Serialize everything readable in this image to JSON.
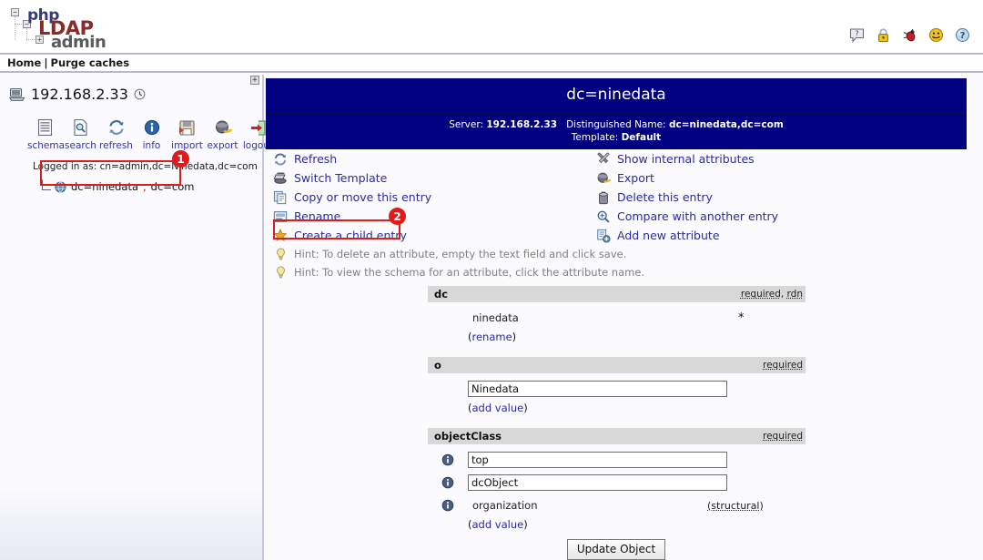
{
  "app": {
    "logo": {
      "part1": "php",
      "part2": "LDAP",
      "part3": "admin"
    },
    "top_icons": [
      {
        "name": "help-bubble-icon",
        "glyph": "?"
      },
      {
        "name": "lock-icon",
        "glyph": "⚿"
      },
      {
        "name": "bug-icon",
        "glyph": "✺"
      },
      {
        "name": "smiley-icon",
        "glyph": "☺"
      },
      {
        "name": "question-help-icon",
        "glyph": "?"
      }
    ]
  },
  "breadcrumb": {
    "home": "Home",
    "separator": "|",
    "purge": "Purge caches"
  },
  "sidebar": {
    "expand_glyph": "+",
    "server": "192.168.2.33",
    "tools": [
      {
        "label": "schema",
        "icon": "schema-icon"
      },
      {
        "label": "search",
        "icon": "search-icon"
      },
      {
        "label": "refresh",
        "icon": "refresh-icon"
      },
      {
        "label": "info",
        "icon": "info-icon"
      },
      {
        "label": "import",
        "icon": "import-icon"
      },
      {
        "label": "export",
        "icon": "export-icon"
      },
      {
        "label": "logout",
        "icon": "logout-icon"
      }
    ],
    "logged_in_label": "Logged in as: ",
    "logged_in_dn": "cn=admin,dc=Ninedata,dc=com",
    "tree_entry": {
      "prefix": "dc=ninedata",
      "comma": ",",
      "suffix": "dc=com"
    }
  },
  "entry": {
    "title": "dc=ninedata",
    "server_label": "Server:",
    "server_value": "192.168.2.33",
    "dn_label": "Distinguished Name:",
    "dn_value": "dc=ninedata,dc=com",
    "template_label": "Template:",
    "template_value": "Default"
  },
  "actions_left": [
    {
      "label": "Refresh",
      "icon": "refresh-icon"
    },
    {
      "label": "Switch Template",
      "icon": "switch-template-icon"
    },
    {
      "label": "Copy or move this entry",
      "icon": "copy-icon"
    },
    {
      "label": "Rename",
      "icon": "rename-icon"
    },
    {
      "label": "Create a child entry",
      "icon": "create-child-star-icon"
    }
  ],
  "actions_right": [
    {
      "label": "Show internal attributes",
      "icon": "tools-icon"
    },
    {
      "label": "Export",
      "icon": "export-icon"
    },
    {
      "label": "Delete this entry",
      "icon": "trash-icon"
    },
    {
      "label": "Compare with another entry",
      "icon": "compare-icon"
    },
    {
      "label": "Add new attribute",
      "icon": "add-attribute-icon"
    }
  ],
  "hints": [
    "Hint: To delete an attribute, empty the text field and click save.",
    "Hint: To view the schema for an attribute, click the attribute name."
  ],
  "attributes": [
    {
      "name": "dc",
      "flags_required": "required",
      "flags_sep": ", ",
      "flags_rdn": "rdn",
      "values": [
        {
          "value": "ninedata",
          "readonly": true,
          "suffix": "*",
          "info_icon": false
        }
      ],
      "action_prefix": "(",
      "action_label": "rename",
      "action_suffix": ")"
    },
    {
      "name": "o",
      "flags_required": "required",
      "flags_sep": "",
      "flags_rdn": "",
      "values": [
        {
          "value": "Ninedata",
          "readonly": false,
          "suffix": "",
          "info_icon": false
        }
      ],
      "action_prefix": "(",
      "action_label": "add value",
      "action_suffix": ")"
    },
    {
      "name": "objectClass",
      "flags_required": "required",
      "flags_sep": "",
      "flags_rdn": "",
      "values": [
        {
          "value": "top",
          "readonly": false,
          "suffix": "",
          "info_icon": true
        },
        {
          "value": "dcObject",
          "readonly": false,
          "suffix": "",
          "info_icon": true
        },
        {
          "value": "organization",
          "readonly": true,
          "suffix": "(structural)",
          "info_icon": true
        }
      ],
      "action_prefix": "(",
      "action_label": "add value",
      "action_suffix": ")"
    }
  ],
  "footer": {
    "update_button": "Update Object"
  },
  "annotations": [
    {
      "id": "1",
      "target": "tree-entry-ninedata"
    },
    {
      "id": "2",
      "target": "create-a-child-entry-link"
    }
  ],
  "colors": {
    "header_navy": "#000080",
    "link_blue": "#2b2b9e",
    "annotation_red": "#e01b1b",
    "attr_header_gray": "#d8d8d8"
  }
}
